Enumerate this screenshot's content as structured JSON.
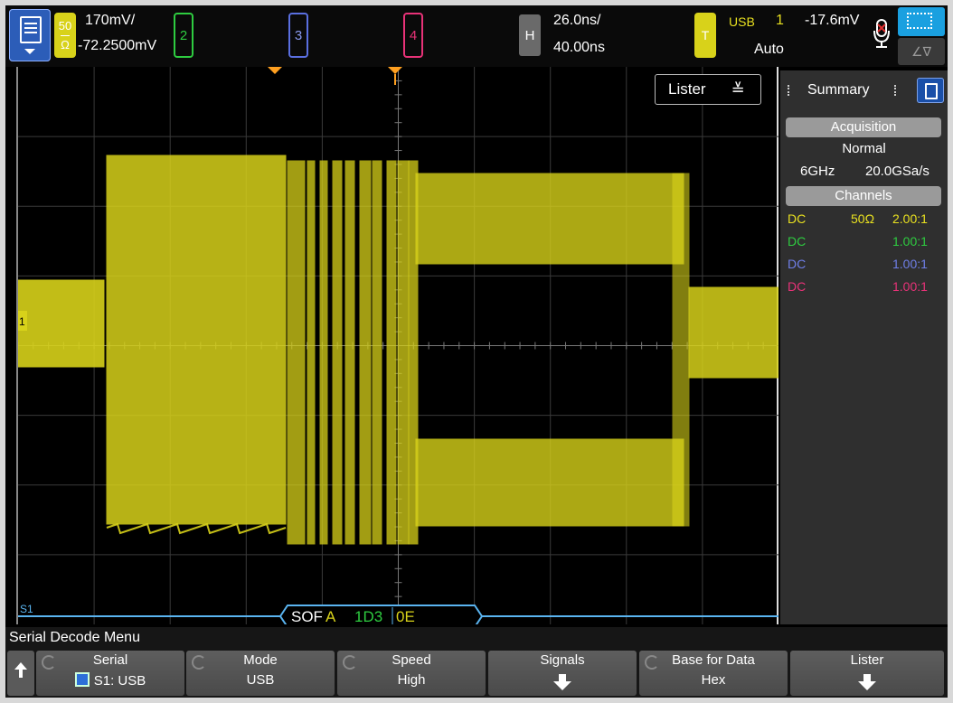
{
  "topbar": {
    "ch1": {
      "impedance_top": "50",
      "impedance_bottom": "Ω",
      "scale": "170mV/",
      "offset": "-72.2500mV"
    },
    "ch2": {
      "label": "2"
    },
    "ch3": {
      "label": "3"
    },
    "ch4": {
      "label": "4"
    },
    "horizontal": {
      "badge": "H",
      "time_per_div": "26.0ns/",
      "delay": "40.00ns"
    },
    "trigger": {
      "badge": "T",
      "source": "USB",
      "channel": "1",
      "level": "-17.6mV",
      "mode": "Auto"
    },
    "aux_button": "∠∇"
  },
  "plot": {
    "lister_button": "Lister",
    "lister_chevron": "≫",
    "ground_marker": "1",
    "serial_label": "S1",
    "decode": {
      "packet": "SOF",
      "field": "A",
      "frame": "1D3",
      "crc": "0E"
    }
  },
  "summary": {
    "title": "Summary",
    "acquisition_header": "Acquisition",
    "mode": "Normal",
    "bandwidth": "6GHz",
    "sample_rate": "20.0GSa/s",
    "channels_header": "Channels",
    "channels": [
      {
        "coupling": "DC",
        "impedance": "50Ω",
        "probe": "2.00:1",
        "color": "#e8e020"
      },
      {
        "coupling": "DC",
        "impedance": "",
        "probe": "1.00:1",
        "color": "#2ecc40"
      },
      {
        "coupling": "DC",
        "impedance": "",
        "probe": "1.00:1",
        "color": "#6f7fe8"
      },
      {
        "coupling": "DC",
        "impedance": "",
        "probe": "1.00:1",
        "color": "#e83278"
      }
    ]
  },
  "menu": {
    "title": "Serial Decode Menu",
    "softkeys": [
      {
        "label": "Serial",
        "value": "S1: USB"
      },
      {
        "label": "Mode",
        "value": "USB"
      },
      {
        "label": "Speed",
        "value": "High"
      },
      {
        "label": "Signals",
        "value": ""
      },
      {
        "label": "Base for Data",
        "value": "Hex"
      },
      {
        "label": "Lister",
        "value": ""
      }
    ]
  },
  "colors": {
    "ch1": "#d8d21a",
    "ch2": "#2ecc40",
    "ch3": "#5a6fe0",
    "ch4": "#e83278",
    "decode_bus": "#5ab4f0",
    "trigger_marker": "#ffa020"
  }
}
